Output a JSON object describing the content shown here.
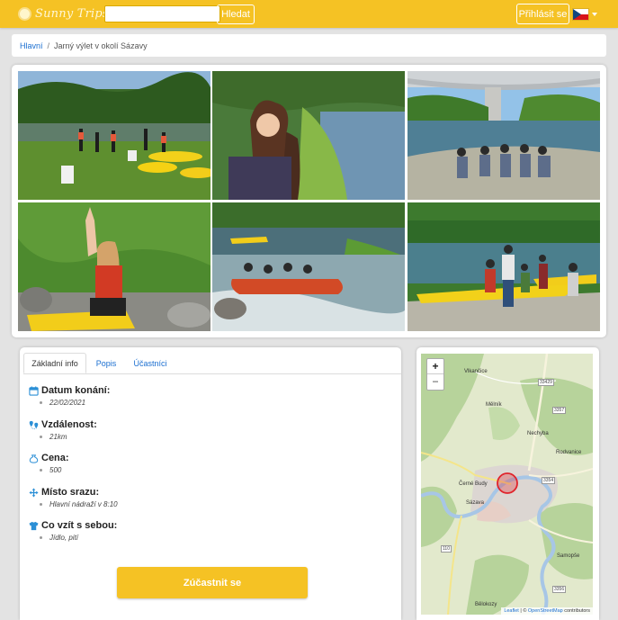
{
  "header": {
    "logo_text": "Sunny Trips",
    "search_placeholder": "",
    "search_button": "Hledat",
    "login_button": "Přihlásit se",
    "language_flag": "cz-flag-icon"
  },
  "breadcrumb": {
    "home": "Hlavní",
    "separator": "/",
    "current": "Jarný výlet v okolí Sázavy"
  },
  "gallery": {
    "photos": [
      "kayaks-on-riverbank-photo",
      "woman-portrait-by-river-photo",
      "group-under-bridge-photo",
      "woman-in-life-vest-photo",
      "raft-on-rapids-photo",
      "group-with-kayaks-photo"
    ]
  },
  "tabs": {
    "basic": "Základní info",
    "description": "Popis",
    "participants": "Účastníci"
  },
  "details": {
    "date_label": "Datum konání:",
    "date_value": "22/02/2021",
    "distance_label": "Vzdálenost:",
    "distance_value": "21km",
    "price_label": "Cena:",
    "price_value": "500",
    "meeting_label": "Místo srazu:",
    "meeting_value": "Hlavní nádraží v 8:10",
    "bring_label": "Co vzít s sebou:",
    "bring_value": "Jídlo, pití"
  },
  "join_button": "Zúčastnit se",
  "map": {
    "zoom_in": "+",
    "zoom_out": "−",
    "labels": {
      "vlkancice": "Vlkančice",
      "melnik": "Mělník",
      "nechyba": "Nechyba",
      "rodvanice": "Rodvanice",
      "cerne_budy": "Černé Budy",
      "sazava": "Sázava",
      "samopse": "Samopše",
      "belokozy": "Bělokozy"
    },
    "roads": [
      "33429",
      "3357",
      "3354",
      "110",
      "3356"
    ],
    "attribution_leaflet": "Leaflet",
    "attribution_sep": " | © ",
    "attribution_osm": "OpenStreetMap",
    "attribution_rest": " contributors",
    "colors": {
      "river": "#a7c6e6",
      "forest": "#b7d39b",
      "town": "#dcd6d2",
      "marker": "#e0232b"
    }
  },
  "colors": {
    "accent": "#f5c224",
    "link": "#1a6ed0"
  }
}
